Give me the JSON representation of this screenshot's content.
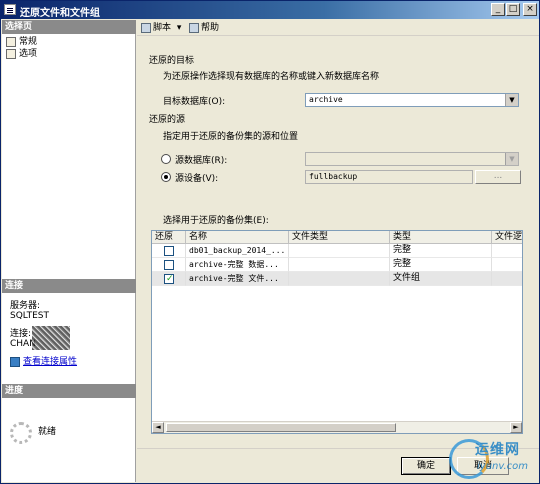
{
  "window": {
    "title": "还原文件和文件组",
    "controls": {
      "minimize": "_",
      "maximize": "□",
      "close": "×"
    }
  },
  "left_pane": {
    "select_page_header": "选择页",
    "nav_items": [
      {
        "label": "常规",
        "icon": "page-icon"
      },
      {
        "label": "选项",
        "icon": "page-icon"
      }
    ],
    "connection_header": "连接",
    "server_label": "服务器:",
    "server_value": "SQLTEST",
    "connection_label": "连接:",
    "connection_value": "CHAN",
    "view_connection_link": "查看连接属性",
    "progress_header": "进度",
    "progress_status": "就绪"
  },
  "toolbar": {
    "script_label": "脚本",
    "script_dropdown": "▾",
    "help_label": "帮助"
  },
  "main": {
    "restore_target_heading": "还原的目标",
    "restore_target_desc": "为还原操作选择现有数据库的名称或键入新数据库名称",
    "target_db_label": "目标数据库(O):",
    "target_db_value": "archive",
    "restore_source_heading": "还原的源",
    "restore_source_desc": "指定用于还原的备份集的源和位置",
    "source_db_label": "源数据库(R):",
    "source_db_value": "",
    "source_device_label": "源设备(V):",
    "source_device_value": "fullbackup",
    "browse_button": "...",
    "selected_source": "device",
    "backup_sets_label": "选择用于还原的备份集(E):",
    "grid": {
      "columns": [
        "还原",
        "名称",
        "文件类型",
        "类型",
        "文件逻"
      ],
      "rows": [
        {
          "restore": false,
          "name": "db01_backup_2014_...",
          "file_type": "",
          "type": "完整",
          "logical": ""
        },
        {
          "restore": false,
          "name": "archive-完整 数据...",
          "file_type": "",
          "type": "完整",
          "logical": ""
        },
        {
          "restore": true,
          "name": "archive-完整 文件...",
          "file_type": "",
          "type": "文件组",
          "logical": ""
        }
      ]
    }
  },
  "footer": {
    "ok_button": "确定",
    "cancel_button": "取消"
  },
  "watermark": {
    "line1": "运维网",
    "line2": "iyunv.com"
  },
  "colors": {
    "title_bar": "#0a246a",
    "section_header": "#8a8a8a",
    "link": "#0000cc"
  }
}
